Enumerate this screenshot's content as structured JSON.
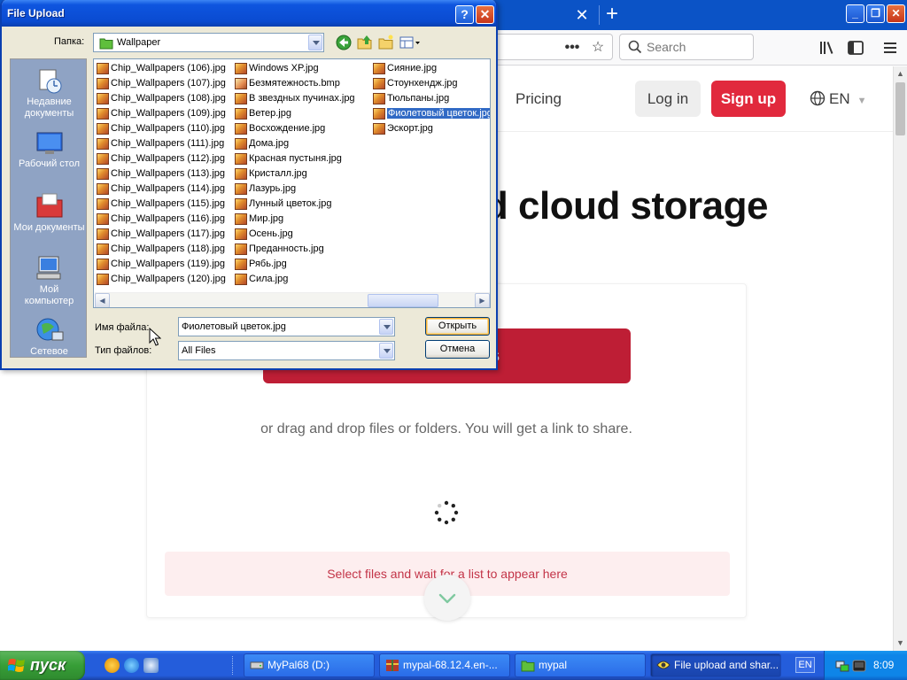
{
  "browser": {
    "search_placeholder": "Search"
  },
  "page": {
    "nav_pricing": "Pricing",
    "login": "Log in",
    "signup": "Sign up",
    "language": "EN",
    "hero_title": "d cloud storage",
    "upload_button_tail": "s",
    "drop_hint": "or drag and drop files or folders. You will get a link to share.",
    "list_hint": "Select files and wait for a list to appear here"
  },
  "dialog": {
    "title": "File Upload",
    "help_icon": "?",
    "folder_label": "Папка:",
    "folder_value": "Wallpaper",
    "places": [
      {
        "line1": "Недавние",
        "line2": "документы"
      },
      {
        "line1": "Рабочий стол",
        "line2": ""
      },
      {
        "line1": "Мои документы",
        "line2": ""
      },
      {
        "line1": "Мой",
        "line2": "компьютер"
      },
      {
        "line1": "Сетевое",
        "line2": ""
      }
    ],
    "files_col1": [
      "Chip_Wallpapers (106).jpg",
      "Chip_Wallpapers (107).jpg",
      "Chip_Wallpapers (108).jpg",
      "Chip_Wallpapers (109).jpg",
      "Chip_Wallpapers (110).jpg",
      "Chip_Wallpapers (111).jpg",
      "Chip_Wallpapers (112).jpg",
      "Chip_Wallpapers (113).jpg",
      "Chip_Wallpapers (114).jpg",
      "Chip_Wallpapers (115).jpg",
      "Chip_Wallpapers (116).jpg",
      "Chip_Wallpapers (117).jpg",
      "Chip_Wallpapers (118).jpg",
      "Chip_Wallpapers (119).jpg",
      "Chip_Wallpapers (120).jpg"
    ],
    "files_col2": [
      "Windows XP.jpg",
      "Безмятежность.bmp",
      "В звездных пучинах.jpg",
      "Ветер.jpg",
      "Восхождение.jpg",
      "Дома.jpg",
      "Красная пустыня.jpg",
      "Кристалл.jpg",
      "Лазурь.jpg",
      "Лунный цветок.jpg",
      "Мир.jpg",
      "Осень.jpg",
      "Преданность.jpg",
      "Рябь.jpg",
      "Сила.jpg"
    ],
    "files_col3": [
      "Сияние.jpg",
      "Стоунхендж.jpg",
      "Тюльпаны.jpg",
      "Фиолетовый цветок.jpg",
      "Эскорт.jpg"
    ],
    "selected_file": "Фиолетовый цветок.jpg",
    "filename_label": "Имя файла:",
    "filename_value": "Фиолетовый цветок.jpg",
    "filetype_label": "Тип файлов:",
    "filetype_value": "All Files",
    "open_button": "Открыть",
    "cancel_button": "Отмена"
  },
  "taskbar": {
    "start_label": "пуск",
    "tasks": [
      {
        "label": "MyPal68 (D:)"
      },
      {
        "label": "mypal-68.12.4.en-..."
      },
      {
        "label": "mypal"
      },
      {
        "label": "File upload and shar..."
      }
    ],
    "language": "EN",
    "clock": "8:09"
  },
  "colors": {
    "signup": "#e1293d",
    "upload_button": "#be1e35",
    "xp_blue": "#0a4bd1",
    "selection": "#316ac5"
  }
}
